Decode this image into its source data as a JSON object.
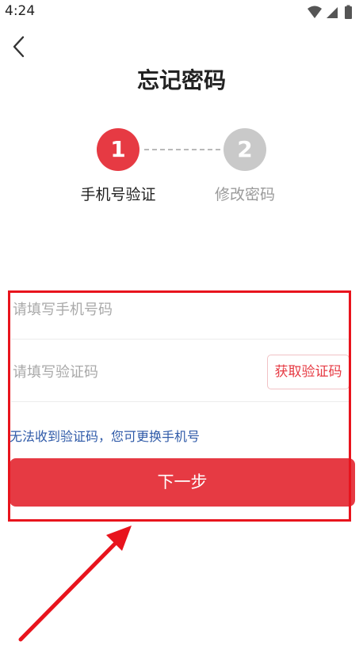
{
  "status_bar": {
    "time": "4:24",
    "icons": [
      "wifi-icon",
      "signal-icon",
      "battery-icon"
    ]
  },
  "header": {
    "back_icon": "chevron-left-icon",
    "title": "忘记密码"
  },
  "steps": [
    {
      "number": "1",
      "label": "手机号验证",
      "state": "active"
    },
    {
      "number": "2",
      "label": "修改密码",
      "state": "inactive"
    }
  ],
  "form": {
    "phone_placeholder": "请填写手机号码",
    "phone_value": "",
    "code_placeholder": "请填写验证码",
    "code_value": "",
    "get_code_label": "获取验证码",
    "change_phone_link": "无法收到验证码，您可更换手机号",
    "next_label": "下一步"
  },
  "colors": {
    "accent": "#e63a43",
    "inactive_step": "#c9c9c9",
    "link": "#2f5aa8",
    "annotation": "#e8141d"
  }
}
